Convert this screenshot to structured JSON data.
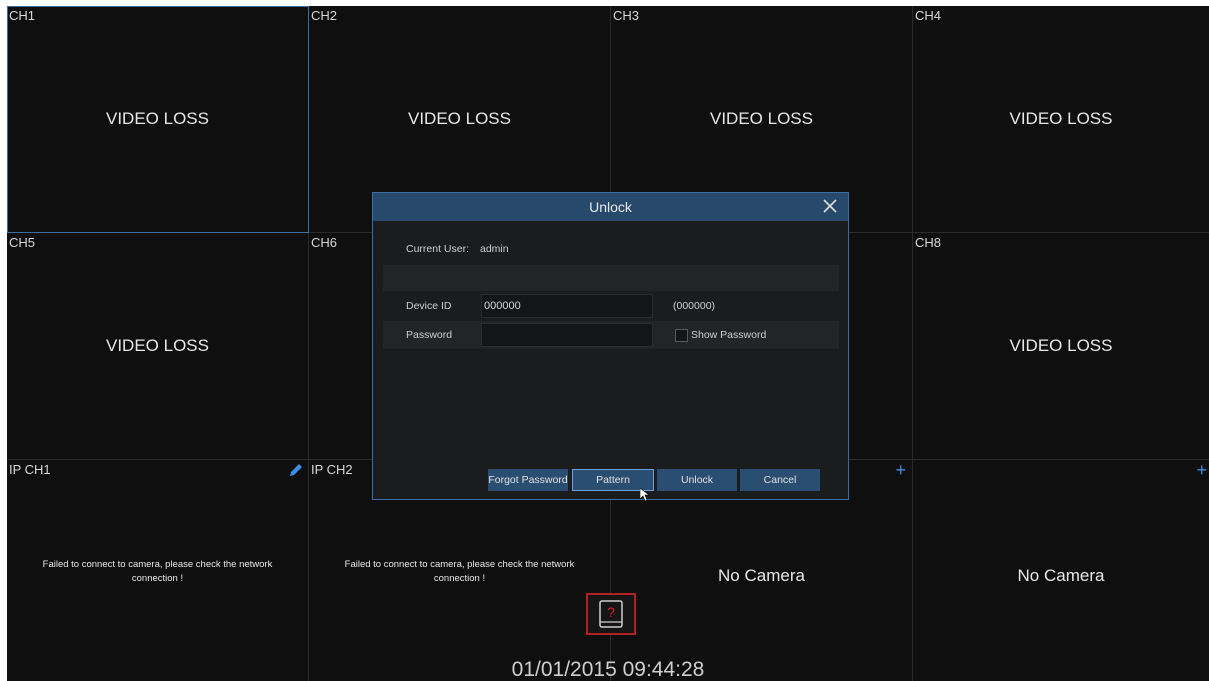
{
  "grid": {
    "cells": {
      "ch1": {
        "label": "CH1",
        "message": "VIDEO LOSS"
      },
      "ch2": {
        "label": "CH2",
        "message": "VIDEO LOSS"
      },
      "ch3": {
        "label": "CH3",
        "message": "VIDEO LOSS"
      },
      "ch4": {
        "label": "CH4",
        "message": "VIDEO LOSS"
      },
      "ch5": {
        "label": "CH5",
        "message": "VIDEO LOSS"
      },
      "ch6": {
        "label": "CH6"
      },
      "ch8": {
        "label": "CH8",
        "message": "VIDEO LOSS"
      },
      "ipch1": {
        "label": "IP CH1",
        "message": "Failed to connect to camera, please check the network connection !",
        "icon": "pencil-edit-icon"
      },
      "ipch2": {
        "label": "IP CH2",
        "message": "Failed to connect to camera, please check the network connection !"
      },
      "ipch3": {
        "message": "No Camera",
        "icon": "plus-add-icon"
      },
      "ipch4": {
        "message": "No Camera",
        "icon": "plus-add-icon"
      }
    }
  },
  "dialog": {
    "title": "Unlock",
    "close_icon": "close-x-icon",
    "current_user_label": "Current User:",
    "current_user_value": "admin",
    "device_id_label": "Device ID",
    "device_id_value": "000000",
    "device_id_hint": "(000000)",
    "password_label": "Password",
    "password_value": "",
    "show_password_label": "Show Password",
    "show_password_checked": false,
    "buttons": {
      "forgot": "Forgot Password",
      "pattern": "Pattern",
      "unlock": "Unlock",
      "cancel": "Cancel"
    }
  },
  "status": {
    "hdd_icon": "hdd-error-icon",
    "hdd_glyph": "?",
    "timestamp": "01/01/2015 09:44:28"
  },
  "colors": {
    "accent": "#3b8ee6",
    "dialog_header": "#27496b",
    "button": "#2a4d72",
    "error": "#b52020"
  }
}
